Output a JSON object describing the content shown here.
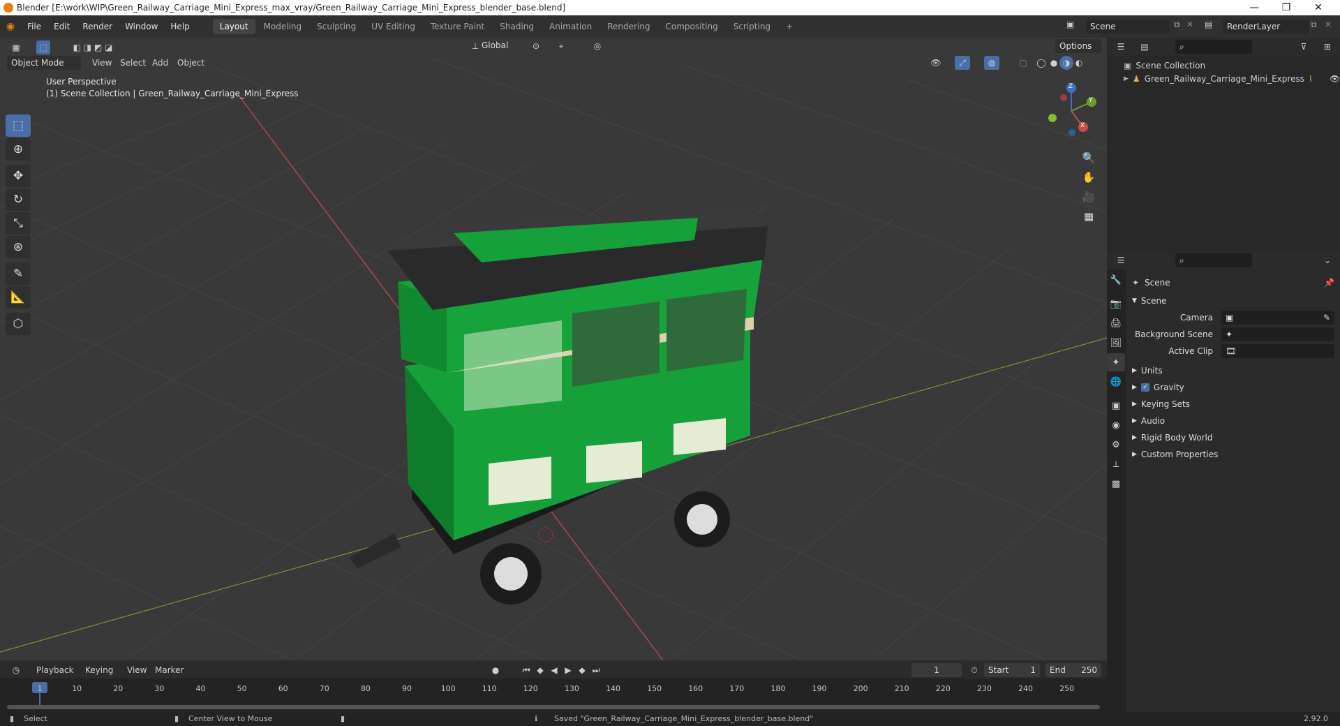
{
  "window": {
    "title": "Blender [E:\\work\\WIP\\Green_Railway_Carriage_Mini_Express_max_vray/Green_Railway_Carriage_Mini_Express_blender_base.blend]",
    "minimize": "—",
    "restore": "❐",
    "close": "✕"
  },
  "menu": {
    "items": [
      "File",
      "Edit",
      "Render",
      "Window",
      "Help"
    ]
  },
  "workspaces": [
    "Layout",
    "Modeling",
    "Sculpting",
    "UV Editing",
    "Texture Paint",
    "Shading",
    "Animation",
    "Rendering",
    "Compositing",
    "Scripting"
  ],
  "workspace_add": "+",
  "scene_field": "Scene",
  "render_layer_field": "RenderLayer",
  "viewport": {
    "mode": "Object Mode",
    "menus": [
      "View",
      "Select",
      "Add",
      "Object"
    ],
    "transform_orientation": "Global",
    "options": "Options",
    "overlay_line1": "User Perspective",
    "overlay_line2": "(1) Scene Collection | Green_Railway_Carriage_Mini_Express",
    "gizmo": {
      "z": "Z",
      "y": "Y",
      "x": "X"
    }
  },
  "outliner": {
    "root": "Scene Collection",
    "items": [
      {
        "label": "Green_Railway_Carriage_Mini_Express"
      }
    ]
  },
  "properties": {
    "context": "Scene",
    "panel": "Scene",
    "rows": [
      {
        "label": "Camera"
      },
      {
        "label": "Background Scene"
      },
      {
        "label": "Active Clip"
      }
    ],
    "sections": [
      "Units",
      "Gravity",
      "Keying Sets",
      "Audio",
      "Rigid Body World",
      "Custom Properties"
    ],
    "gravity_checked": true
  },
  "timeline": {
    "menus": [
      "Playback",
      "Keying",
      "View",
      "Marker"
    ],
    "current_frame": "1",
    "start_label": "Start",
    "start": "1",
    "end_label": "End",
    "end": "250",
    "ticks": [
      "1",
      "10",
      "20",
      "30",
      "40",
      "50",
      "60",
      "70",
      "80",
      "90",
      "100",
      "110",
      "120",
      "130",
      "140",
      "150",
      "160",
      "170",
      "180",
      "190",
      "200",
      "210",
      "220",
      "230",
      "240",
      "250"
    ]
  },
  "status": {
    "left": "Select",
    "middle": "Center View to Mouse",
    "message": "Saved \"Green_Railway_Carriage_Mini_Express_blender_base.blend\"",
    "version": "2.92.0"
  },
  "colors": {
    "accent": "#4a6ea8",
    "x_axis": "#c84b4b",
    "y_axis": "#6d9b2d",
    "z_axis": "#3b72c8",
    "carriage_green": "#15a03a"
  }
}
